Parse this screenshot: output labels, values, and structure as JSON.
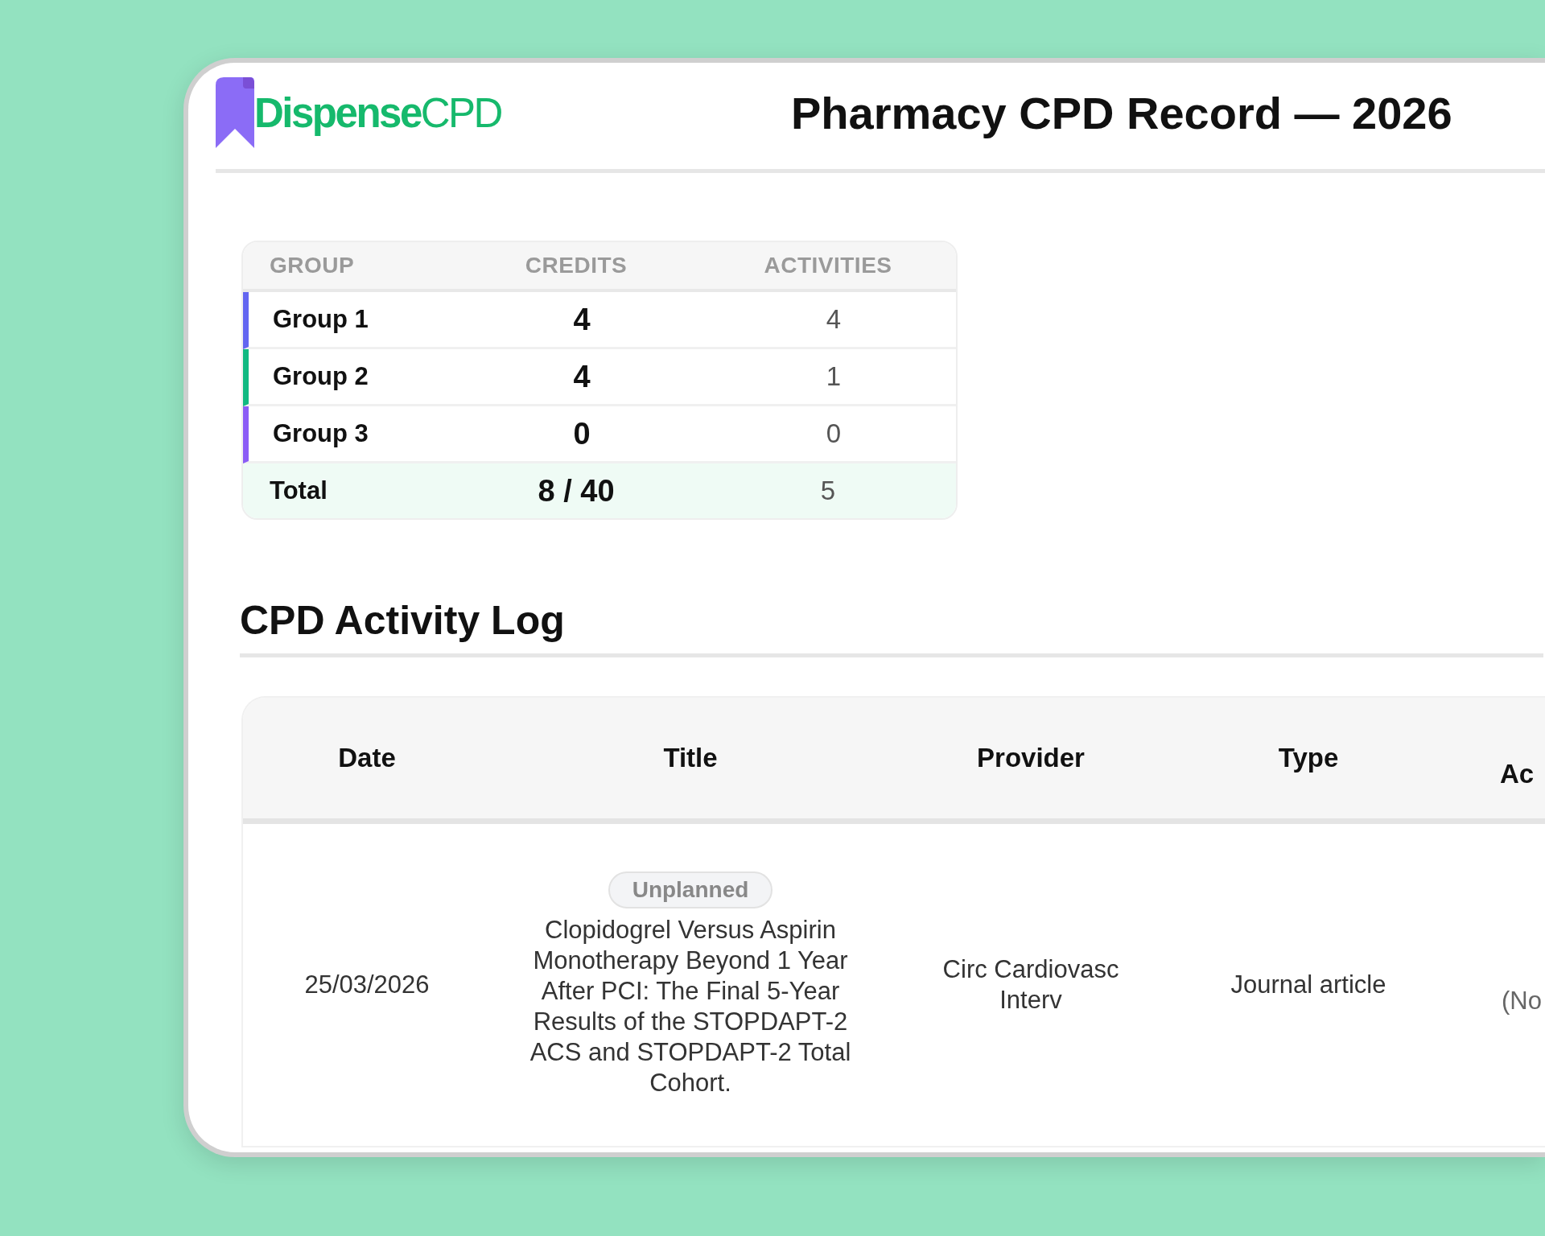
{
  "logo": {
    "text": "**Dispense**CPD"
  },
  "title": "Pharmacy CPD Record — 2026",
  "summary": {
    "columns": [
      "GROUP",
      "CREDITS",
      "ACTIVITIES"
    ],
    "rows": [
      {
        "group": "Group 1",
        "credits": "4",
        "activities": "4",
        "color": "#6366f1"
      },
      {
        "group": "Group 2",
        "credits": "4",
        "activities": "1",
        "color": "#10b981"
      },
      {
        "group": "Group 3",
        "credits": "0",
        "activities": "0",
        "color": "#8b5cf6"
      }
    ],
    "total": {
      "label": "Total",
      "credits": "8 / 40",
      "activities": "5"
    }
  },
  "log": {
    "heading": "CPD Activity Log",
    "columns": [
      "Date",
      "Title",
      "Provider",
      "Type",
      "Ac"
    ],
    "rows": [
      {
        "date": "25/03/2026",
        "badge": "Unplanned",
        "title": "Clopidogrel Versus Aspirin Monotherapy Beyond 1 Year After PCI: The Final 5-Year Results of the STOPDAPT-2 ACS and STOPDAPT-2 Total Cohort.",
        "provider": "Circ Cardiovasc Interv",
        "type": "Journal article",
        "column_5": "(No"
      }
    ]
  }
}
